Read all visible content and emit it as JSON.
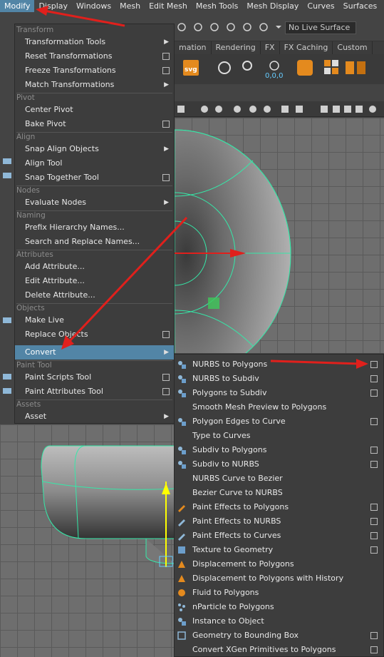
{
  "menubar": [
    "Modify",
    "Display",
    "Windows",
    "Mesh",
    "Edit Mesh",
    "Mesh Tools",
    "Mesh Display",
    "Curves",
    "Surfaces"
  ],
  "toolbar": {
    "live_surface": "No Live Surface"
  },
  "shelf_tabs": [
    "mation",
    "Rendering",
    "FX",
    "FX Caching",
    "Custom"
  ],
  "modify_menu": {
    "sections": {
      "transform": "Transform",
      "pivot": "Pivot",
      "align": "Align",
      "nodes": "Nodes",
      "naming": "Naming",
      "attributes": "Attributes",
      "objects": "Objects",
      "paint_tool": "Paint Tool",
      "assets": "Assets"
    },
    "items": {
      "transformation_tools": "Transformation Tools",
      "reset_transformations": "Reset Transformations",
      "freeze_transformations": "Freeze Transformations",
      "match_transformations": "Match Transformations",
      "center_pivot": "Center Pivot",
      "bake_pivot": "Bake Pivot",
      "snap_align_objects": "Snap Align Objects",
      "align_tool": "Align Tool",
      "snap_together_tool": "Snap Together Tool",
      "evaluate_nodes": "Evaluate Nodes",
      "prefix_hierarchy_names": "Prefix Hierarchy Names...",
      "search_and_replace_names": "Search and Replace Names...",
      "add_attribute": "Add Attribute...",
      "edit_attribute": "Edit Attribute...",
      "delete_attribute": "Delete Attribute...",
      "make_live": "Make Live",
      "replace_objects": "Replace Objects",
      "convert": "Convert",
      "paint_scripts_tool": "Paint Scripts Tool",
      "paint_attributes_tool": "Paint Attributes Tool",
      "asset": "Asset"
    }
  },
  "convert_submenu": [
    {
      "label": "NURBS to Polygons",
      "option": true
    },
    {
      "label": "NURBS to Subdiv",
      "option": true
    },
    {
      "label": "Polygons to Subdiv",
      "option": true
    },
    {
      "label": "Smooth Mesh Preview to Polygons",
      "option": false
    },
    {
      "label": "Polygon Edges to Curve",
      "option": true
    },
    {
      "label": "Type to Curves",
      "option": false
    },
    {
      "label": "Subdiv to Polygons",
      "option": true
    },
    {
      "label": "Subdiv to NURBS",
      "option": true
    },
    {
      "label": "NURBS Curve to Bezier",
      "option": false
    },
    {
      "label": "Bezier Curve to NURBS",
      "option": false
    },
    {
      "label": "Paint Effects to Polygons",
      "option": true
    },
    {
      "label": "Paint Effects to NURBS",
      "option": true
    },
    {
      "label": "Paint Effects to Curves",
      "option": true
    },
    {
      "label": "Texture to Geometry",
      "option": true
    },
    {
      "label": "Displacement to Polygons",
      "option": false
    },
    {
      "label": "Displacement to Polygons with History",
      "option": false
    },
    {
      "label": "Fluid to Polygons",
      "option": false
    },
    {
      "label": "nParticle to Polygons",
      "option": false
    },
    {
      "label": "Instance to Object",
      "option": false
    },
    {
      "label": "Geometry to Bounding Box",
      "option": true
    },
    {
      "label": "Convert XGen Primitives to Polygons",
      "option": true
    }
  ],
  "colors": {
    "highlight": "#5285a6",
    "annotation_arrow": "#e0201c",
    "wire": "#35e8a8"
  }
}
